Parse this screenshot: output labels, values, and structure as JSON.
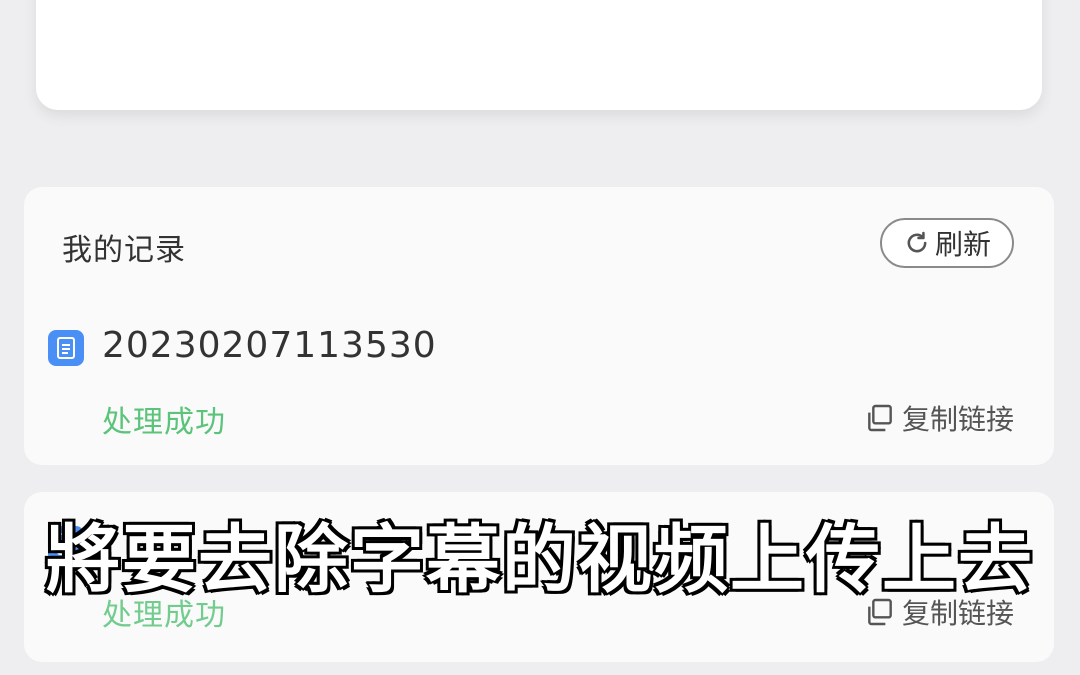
{
  "records": {
    "title": "我的记录",
    "refresh_label": "刷新",
    "items": [
      {
        "id": "20230207113530",
        "status": "处理成功",
        "copy_label": "复制链接"
      },
      {
        "status": "处理成功",
        "copy_label": "复制链接"
      }
    ]
  },
  "overlay": {
    "subtitle": "將要去除字幕的视频上传上去"
  },
  "colors": {
    "accent": "#4a8ff5",
    "success": "#5bc47a"
  }
}
